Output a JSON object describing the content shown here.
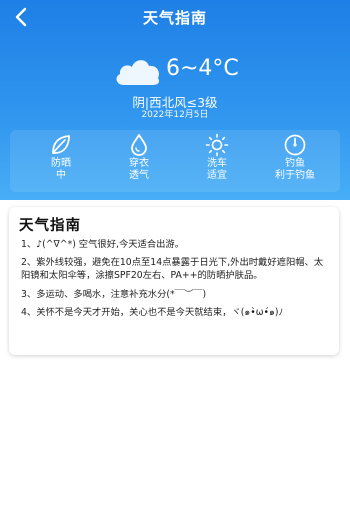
{
  "header": {
    "title": "天气指南",
    "back_icon": "chevron-left-icon"
  },
  "weather": {
    "icon": "cloud-icon",
    "temperature": "6~4°C",
    "condition": "阴|西北风≤3级",
    "date": "2022年12月5日"
  },
  "indices": [
    {
      "icon": "leaf-icon",
      "label": "防晒",
      "value": "中"
    },
    {
      "icon": "water-drop-icon",
      "label": "穿衣",
      "value": "透气"
    },
    {
      "icon": "sun-icon",
      "label": "洗车",
      "value": "适宜"
    },
    {
      "icon": "gauge-icon",
      "label": "钓鱼",
      "value": "利于钓鱼"
    }
  ],
  "guide": {
    "title": "天气指南",
    "items": [
      "1、♪(^∇^*)  空气很好,今天适合出游。",
      "2、紫外线较强，避免在10点至14点暴露于日光下,外出时戴好遮阳帽、太阳镜和太阳伞等，涂擦SPF20左右、PA++的防晒护肤品。",
      "3、多运动、多喝水，注意补充水分(*￣︶￣)",
      "4、关怀不是今天才开始，关心也不是今天就结束，ヾ(๑•̀ω•́๑)ﾉ"
    ]
  },
  "colors": {
    "hero_top": "#1e7fe6",
    "hero_bottom": "#47aef6",
    "text_light": "#ffffff",
    "text_dark": "#1e1e1e"
  }
}
